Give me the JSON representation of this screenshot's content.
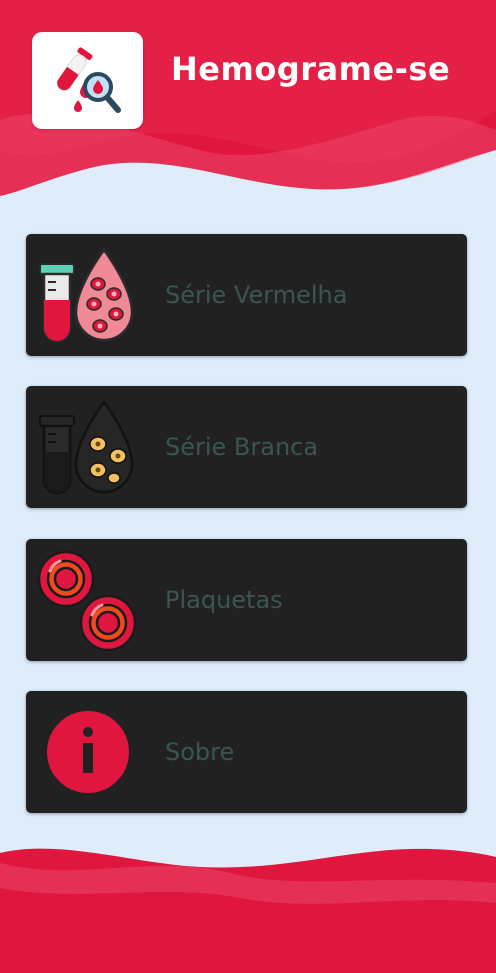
{
  "header": {
    "app_title": "Hemograme-se",
    "logo_icon": "blood-test-magnifier-icon"
  },
  "menu": {
    "items": [
      {
        "label": "Série Vermelha",
        "icon": "red-blood-cells-test-tube-icon"
      },
      {
        "label": "Série Branca",
        "icon": "white-blood-cells-test-tube-icon"
      },
      {
        "label": "Plaquetas",
        "icon": "platelets-icon"
      },
      {
        "label": "Sobre",
        "icon": "info-icon"
      }
    ]
  },
  "colors": {
    "primary": "#e0163f",
    "background": "#dfedfb",
    "card": "#212121",
    "card_text": "#3a5555"
  }
}
